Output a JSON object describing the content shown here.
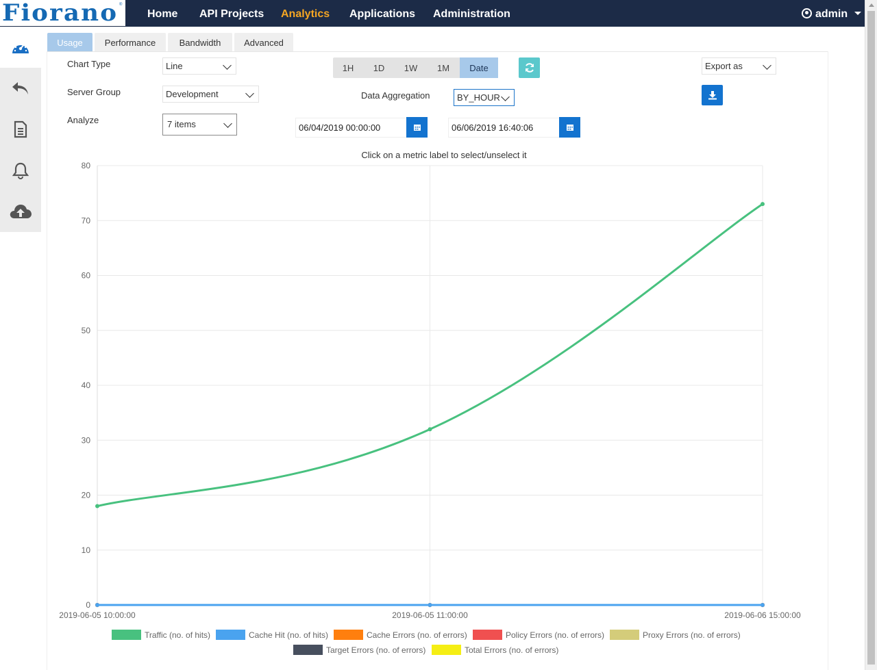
{
  "brand": {
    "logo_text": "Fiorano",
    "mark": "®"
  },
  "nav": {
    "items": [
      {
        "label": "Home",
        "active": false
      },
      {
        "label": "API Projects",
        "active": false
      },
      {
        "label": "Analytics",
        "active": true
      },
      {
        "label": "Applications",
        "active": false
      },
      {
        "label": "Administration",
        "active": false
      }
    ],
    "user": "admin"
  },
  "sidebar": {
    "items": [
      {
        "icon": "dashboard-gauge-icon",
        "active": true
      },
      {
        "icon": "undo-arrow-icon",
        "active": false
      },
      {
        "icon": "document-icon",
        "active": false
      },
      {
        "icon": "bell-icon",
        "active": false
      },
      {
        "icon": "cloud-upload-icon",
        "active": false
      }
    ]
  },
  "tabs": [
    {
      "label": "Usage",
      "active": true
    },
    {
      "label": "Performance",
      "active": false
    },
    {
      "label": "Bandwidth",
      "active": false
    },
    {
      "label": "Advanced",
      "active": false
    }
  ],
  "controls": {
    "chart_type": {
      "label": "Chart Type",
      "value": "Line"
    },
    "server_group": {
      "label": "Server Group",
      "value": "Development"
    },
    "analyze": {
      "label": "Analyze",
      "value": "7 items"
    },
    "ranges": [
      {
        "label": "1H",
        "active": false
      },
      {
        "label": "1D",
        "active": false
      },
      {
        "label": "1W",
        "active": false
      },
      {
        "label": "1M",
        "active": false
      },
      {
        "label": "Date",
        "active": true
      }
    ],
    "data_aggregation": {
      "label": "Data Aggregation",
      "value": "BY_HOUR"
    },
    "export": {
      "value": "Export as"
    },
    "start_date": "06/04/2019 00:00:00",
    "end_date": "06/06/2019 16:40:06",
    "refresh_color": "#5bc8cc",
    "accent_color": "#1373cf"
  },
  "chart_hint": "Click on a metric label to select/unselect it",
  "chart_data": {
    "type": "line",
    "title": "",
    "xlabel": "",
    "ylabel": "",
    "categories": [
      "2019-06-05 10:00:00",
      "2019-06-05 11:00:00",
      "2019-06-06 15:00:00"
    ],
    "ylim": [
      0,
      80
    ],
    "yticks": [
      0,
      10,
      20,
      30,
      40,
      50,
      60,
      70,
      80
    ],
    "grid": true,
    "legend_position": "bottom",
    "series": [
      {
        "name": "Traffic (no. of hits)",
        "color": "#48c17f",
        "values": [
          18,
          32,
          73
        ]
      },
      {
        "name": "Cache Hit (no. of hits)",
        "color": "#4aa3ef",
        "values": [
          0,
          0,
          0
        ]
      },
      {
        "name": "Cache Errors (no. of errors)",
        "color": "#ff7f0e",
        "values": [
          0,
          0,
          0
        ]
      },
      {
        "name": "Policy Errors (no. of errors)",
        "color": "#f05050",
        "values": [
          0,
          0,
          0
        ]
      },
      {
        "name": "Proxy Errors (no. of errors)",
        "color": "#d4cc7a",
        "values": [
          0,
          0,
          0
        ]
      },
      {
        "name": "Target Errors (no. of errors)",
        "color": "#474f5e",
        "values": [
          0,
          0,
          0
        ]
      },
      {
        "name": "Total Errors (no. of errors)",
        "color": "#f5ee14",
        "values": [
          0,
          0,
          0
        ]
      }
    ]
  }
}
